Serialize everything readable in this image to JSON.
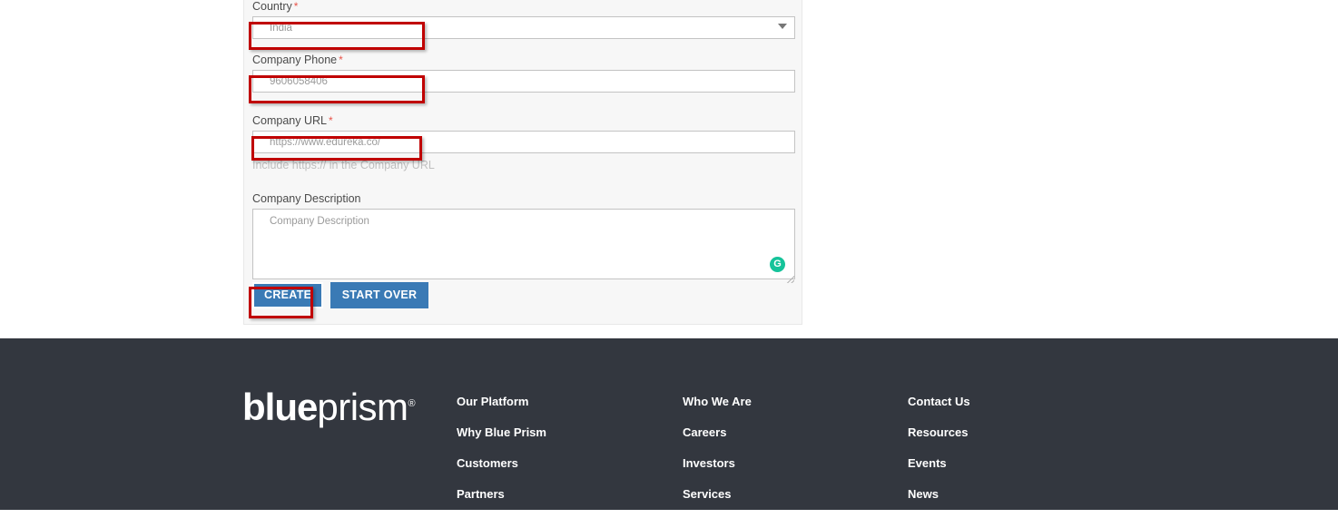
{
  "form": {
    "fields": [
      {
        "name": "country",
        "label": "Country",
        "required_marker": "*",
        "value": "India",
        "placeholder": "India",
        "type": "select",
        "arrow_icon": "chevron-down-icon"
      },
      {
        "name": "company_phone",
        "label": "Company Phone",
        "required_marker": "*",
        "value": "9606058406",
        "placeholder": "9606058406",
        "type": "text"
      },
      {
        "name": "company_url",
        "label": "Company URL",
        "required_marker": "*",
        "value": "https://www.edureka.co/",
        "placeholder": "https://www.edureka.co/",
        "type": "text",
        "help_text": "Include https:// in the Company URL"
      },
      {
        "name": "company_description",
        "label": "Company Description",
        "required_marker": "",
        "value": "",
        "placeholder": "Company Description",
        "type": "textarea",
        "badge_icon": "grammarly-icon",
        "badge_letter": "G",
        "resize_icon": "resize-grip-icon"
      }
    ],
    "buttons": {
      "create_label": "CREATE",
      "start_over_label": "START OVER"
    },
    "colors": {
      "button_blue": "#3a7ab5",
      "required_red": "#e8544a",
      "annotation_red": "#c00000",
      "grammarly_green": "#15c39a",
      "panel_background": "#f7f7f7"
    }
  },
  "footer": {
    "logo": {
      "bold_part": "blue",
      "light_part": "prism",
      "registered_mark": "®"
    },
    "background_color": "#33373f",
    "columns": [
      {
        "name": "platform",
        "links": [
          "Our Platform",
          "Why Blue Prism",
          "Customers",
          "Partners"
        ]
      },
      {
        "name": "company",
        "links": [
          "Who We Are",
          "Careers",
          "Investors",
          "Services"
        ]
      },
      {
        "name": "connect",
        "links": [
          "Contact Us",
          "Resources",
          "Events",
          "News"
        ]
      }
    ]
  }
}
